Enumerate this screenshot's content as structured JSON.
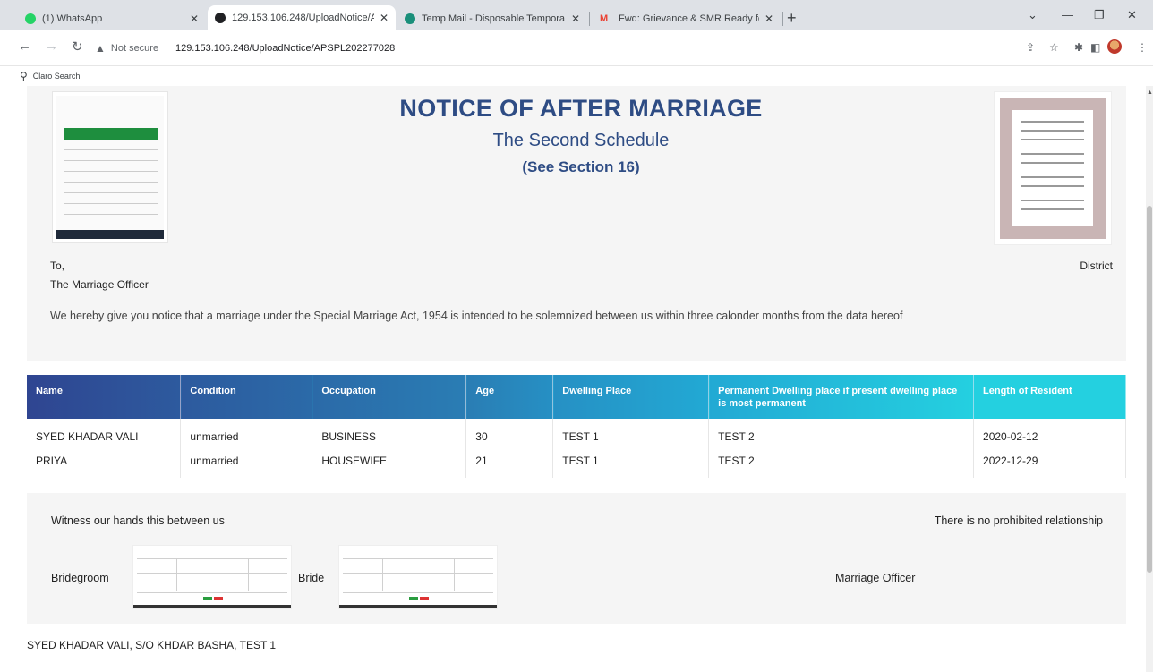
{
  "browser": {
    "tabs": [
      {
        "title": "(1) WhatsApp",
        "color": "#25d366"
      },
      {
        "title": "129.153.106.248/UploadNotice/A",
        "color": "#202124"
      },
      {
        "title": "Temp Mail - Disposable Tempora",
        "color": "#1a8f7a"
      },
      {
        "title": "Fwd: Grievance & SMR Ready for",
        "color": "#ea4335"
      }
    ],
    "new_tab_label": "+",
    "address": {
      "security_label": "Not secure",
      "url": "129.153.106.248/UploadNotice/APSPL202277028"
    },
    "bookmark": "Claro Search"
  },
  "notice": {
    "title": "NOTICE OF AFTER MARRIAGE",
    "subtitle": "The Second Schedule",
    "section": "(See Section 16)",
    "to": "To,",
    "recipient": "The Marriage Officer",
    "district": "District",
    "body": "We hereby give you notice that a marriage under the Special Marriage Act, 1954 is intended to be solemnized between us within three calonder months from the data hereof"
  },
  "table": {
    "headers": [
      "Name",
      "Condition",
      "Occupation",
      "Age",
      "Dwelling Place",
      "Permanent Dwelling place if present dwelling place is most permanent",
      "Length of Resident"
    ],
    "header_colors": [
      "#2f4591",
      "#2d5a9e",
      "#2b6aa8",
      "#2a7db4",
      "#2690c4",
      "#22a9d4",
      "#24d0e0"
    ],
    "rows": [
      [
        "SYED KHADAR VALI",
        "unmarried",
        "BUSINESS",
        "30",
        "TEST 1",
        "TEST 2",
        "2020-02-12"
      ],
      [
        "PRIYA",
        "unmarried",
        "HOUSEWIFE",
        "21",
        "TEST 1",
        "TEST 2",
        "2022-12-29"
      ]
    ]
  },
  "signatures": {
    "witness_text": "Witness our hands this between us",
    "no_prohibited": "There is no prohibited relationship",
    "bridegroom_label": "Bridegroom",
    "bride_label": "Bride",
    "marriage_officer_label": "Marriage Officer"
  },
  "footer_line": "SYED KHADAR VALI, S/O KHDAR BASHA, TEST 1"
}
